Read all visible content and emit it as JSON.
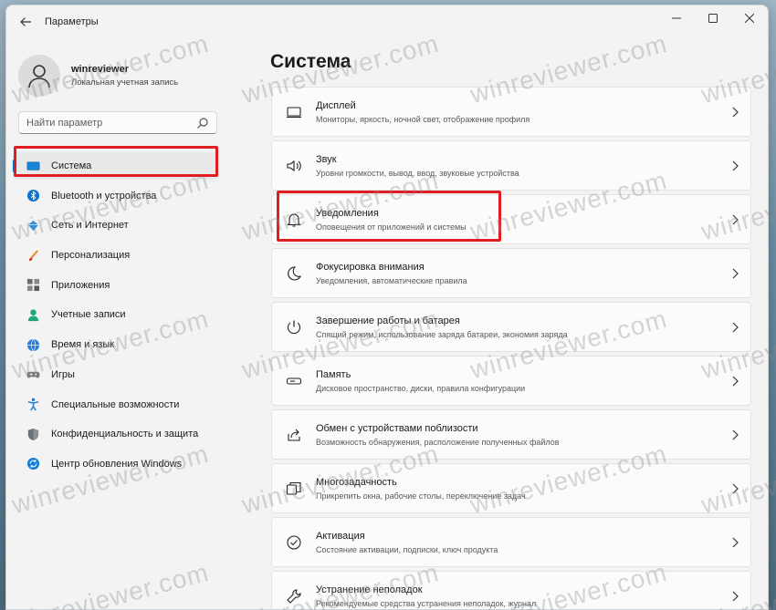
{
  "app": {
    "title": "Параметры"
  },
  "user": {
    "name": "winreviewer",
    "account_type": "Локальная учетная запись"
  },
  "search": {
    "placeholder": "Найти параметр"
  },
  "nav": [
    {
      "label": "Система",
      "icon": "monitor-icon"
    },
    {
      "label": "Bluetooth и устройства",
      "icon": "bluetooth-icon"
    },
    {
      "label": "Сеть и Интернет",
      "icon": "network-icon"
    },
    {
      "label": "Персонализация",
      "icon": "brush-icon"
    },
    {
      "label": "Приложения",
      "icon": "apps-icon"
    },
    {
      "label": "Учетные записи",
      "icon": "user-icon"
    },
    {
      "label": "Время и язык",
      "icon": "globe-clock-icon"
    },
    {
      "label": "Игры",
      "icon": "gamepad-icon"
    },
    {
      "label": "Специальные возможности",
      "icon": "accessibility-icon"
    },
    {
      "label": "Конфиденциальность и защита",
      "icon": "shield-icon"
    },
    {
      "label": "Центр обновления Windows",
      "icon": "update-icon"
    }
  ],
  "main": {
    "title": "Система",
    "cards": [
      {
        "title": "Дисплей",
        "subtitle": "Мониторы, яркость, ночной свет, отображение профиля",
        "icon": "display-icon"
      },
      {
        "title": "Звук",
        "subtitle": "Уровни громкости, вывод, ввод, звуковые устройства",
        "icon": "speaker-icon"
      },
      {
        "title": "Уведомления",
        "subtitle": "Оповещения от приложений и системы",
        "icon": "bell-icon"
      },
      {
        "title": "Фокусировка внимания",
        "subtitle": "Уведомления, автоматические правила",
        "icon": "moon-icon"
      },
      {
        "title": "Завершение работы и батарея",
        "subtitle": "Спящий режим, использование заряда батареи, экономия заряда",
        "icon": "power-icon"
      },
      {
        "title": "Память",
        "subtitle": "Дисковое пространство, диски, правила конфигурации",
        "icon": "storage-icon"
      },
      {
        "title": "Обмен с устройствами поблизости",
        "subtitle": "Возможность обнаружения, расположение полученных файлов",
        "icon": "share-icon"
      },
      {
        "title": "Многозадачность",
        "subtitle": "Прикрепить окна, рабочие столы, переключение задач",
        "icon": "multitask-icon"
      },
      {
        "title": "Активация",
        "subtitle": "Состояние активации, подписки, ключ продукта",
        "icon": "check-circle-icon"
      },
      {
        "title": "Устранение неполадок",
        "subtitle": "Рекомендуемые средства устранения неполадок, журнал",
        "icon": "wrench-icon"
      }
    ]
  },
  "watermark": {
    "text": "winreviewer.com"
  },
  "colors": {
    "accent": "#0067c0",
    "highlight": "#e11d24"
  }
}
